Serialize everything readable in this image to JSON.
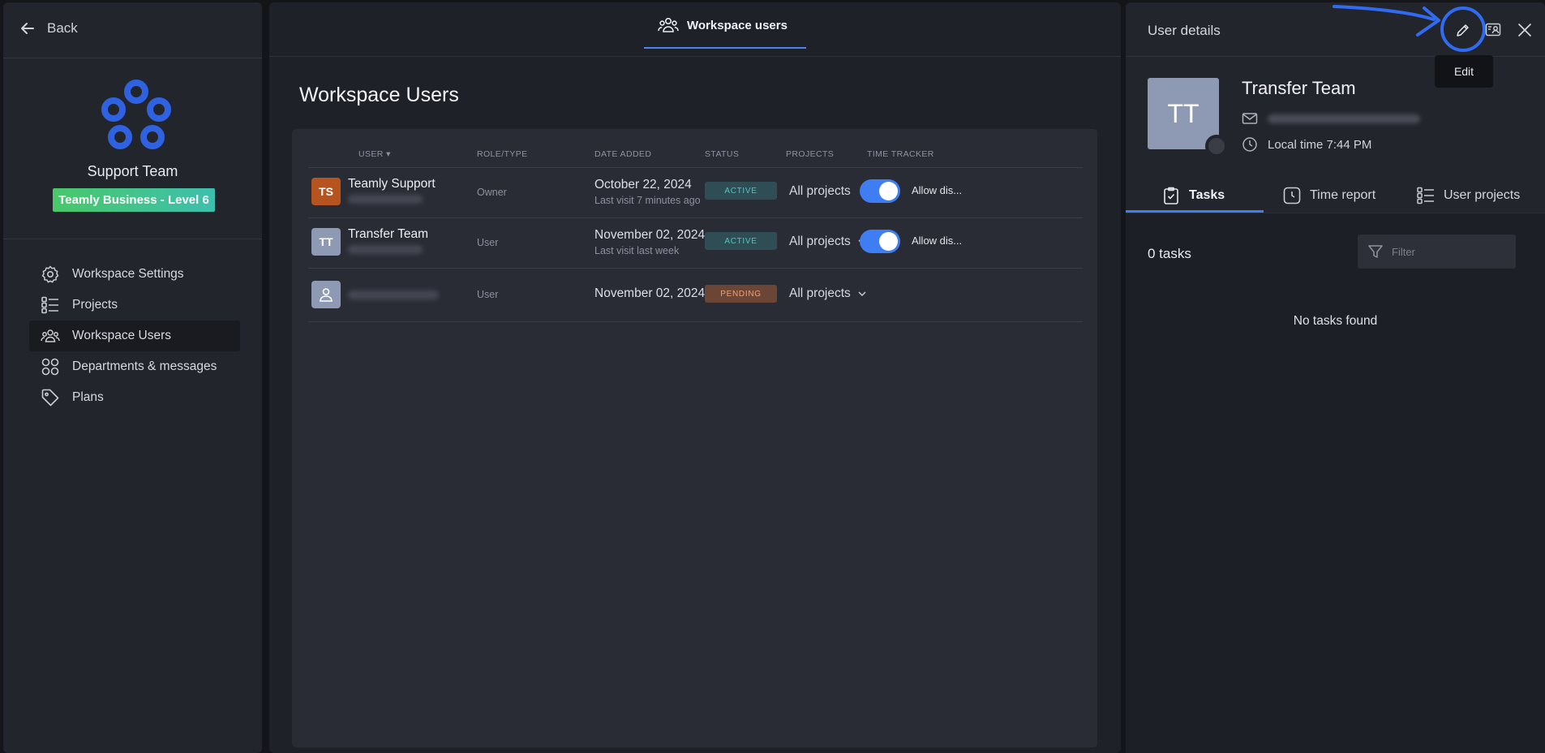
{
  "left": {
    "back_label": "Back",
    "team_name": "Support Team",
    "plan_badge": "Teamly Business - Level 6",
    "nav": [
      {
        "label": "Workspace Settings",
        "icon": "gear-icon"
      },
      {
        "label": "Projects",
        "icon": "list-icon"
      },
      {
        "label": "Workspace Users",
        "icon": "users-icon",
        "active": true
      },
      {
        "label": "Departments & messages",
        "icon": "grid-icon"
      },
      {
        "label": "Plans",
        "icon": "tag-icon"
      }
    ]
  },
  "center": {
    "tab_label": "Workspace users",
    "page_title": "Workspace Users",
    "columns": [
      "USER",
      "ROLE/TYPE",
      "DATE ADDED",
      "STATUS",
      "PROJECTS",
      "TIME TRACKER"
    ],
    "rows": [
      {
        "initials": "TS",
        "name": "Teamly Support",
        "role": "Owner",
        "date": "October 22, 2024",
        "last_visit": "Last visit 7 minutes ago",
        "status": "ACTIVE",
        "projects": "All projects",
        "tracker": "Allow dis..."
      },
      {
        "initials": "TT",
        "name": "Transfer Team",
        "role": "User",
        "date": "November 02, 2024",
        "last_visit": "Last visit last week",
        "status": "ACTIVE",
        "projects": "All projects",
        "tracker": "Allow dis..."
      },
      {
        "initials": "",
        "name": "",
        "role": "User",
        "date": "November 02, 2024",
        "last_visit": "",
        "status": "PENDING",
        "projects": "All projects",
        "tracker": ""
      }
    ]
  },
  "right": {
    "title": "User details",
    "tooltip": "Edit",
    "initials": "TT",
    "name": "Transfer Team",
    "local_time": "Local time 7:44 PM",
    "tabs": [
      "Tasks",
      "Time report",
      "User projects"
    ],
    "task_count": "0 tasks",
    "filter_placeholder": "Filter",
    "empty": "No tasks found"
  },
  "colors": {
    "accent": "#3f7ef2",
    "active_status": "#48c9c3",
    "pending_status": "#f0a27a",
    "avatar_ts": "#b5541f",
    "avatar_tt": "#8e99b3"
  }
}
